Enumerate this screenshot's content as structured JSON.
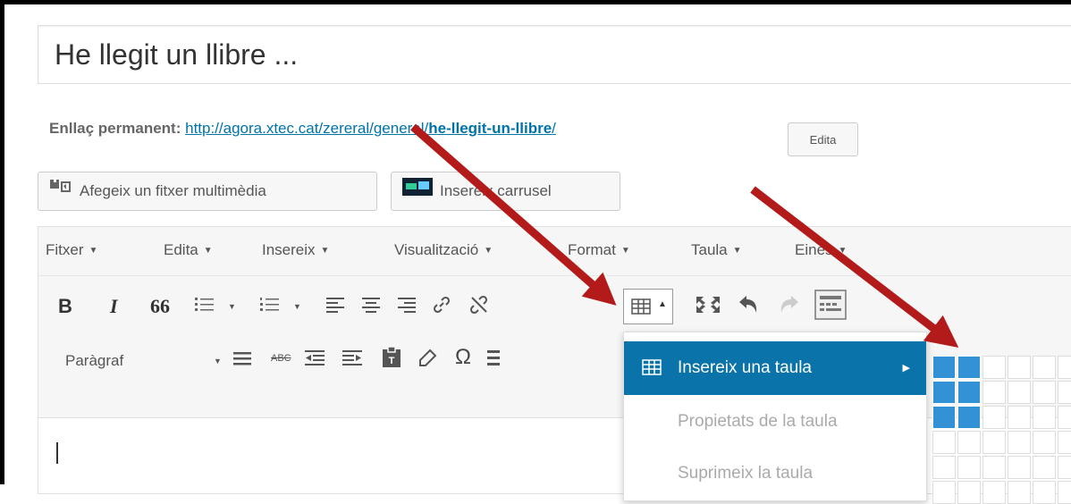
{
  "post": {
    "title_value": "He llegit un llibre ...",
    "permalink_label": "Enllaç permanent:",
    "permalink_url_base": "http://agora.xtec.cat/zereral/general/",
    "permalink_slug": "he-llegit-un-llibre",
    "permalink_trailing_slash": "/",
    "edit_label": "Edita"
  },
  "media_buttons": {
    "add_media": "Afegeix un fitxer multimèdia",
    "carousel": "Insereix carrusel"
  },
  "menubar": [
    {
      "label": "Fitxer"
    },
    {
      "label": "Edita"
    },
    {
      "label": "Insereix"
    },
    {
      "label": "Visualització"
    },
    {
      "label": "Format"
    },
    {
      "label": "Taula"
    },
    {
      "label": "Eines"
    }
  ],
  "toolbar": {
    "bold": "B",
    "italic": "I",
    "blockquote": "66",
    "format_select": "Paràgraf",
    "special_char": "Ω",
    "spellcheck": "ABC"
  },
  "table_menu": {
    "items": [
      {
        "label": "Insereix una taula"
      },
      {
        "label": "Propietats de la taula"
      },
      {
        "label": "Suprimeix la taula"
      }
    ],
    "grid_selected_cols": 2,
    "grid_selected_rows": 3
  },
  "icons": [
    "add-media-icon",
    "carousel-icon",
    "bullet-list-icon",
    "numbered-list-icon",
    "align-left-icon",
    "align-center-icon",
    "align-right-icon",
    "link-icon",
    "unlink-icon",
    "table-icon",
    "fullscreen-icon",
    "undo-icon",
    "redo-icon",
    "toolbar-toggle-icon",
    "horizontal-rule-icon",
    "outdent-icon",
    "indent-icon",
    "paste-text-icon",
    "clear-format-icon"
  ],
  "colors": {
    "accent": "#0a73aa",
    "grid_selected": "#3392d6",
    "annotation_arrow": "#b31b1b"
  }
}
